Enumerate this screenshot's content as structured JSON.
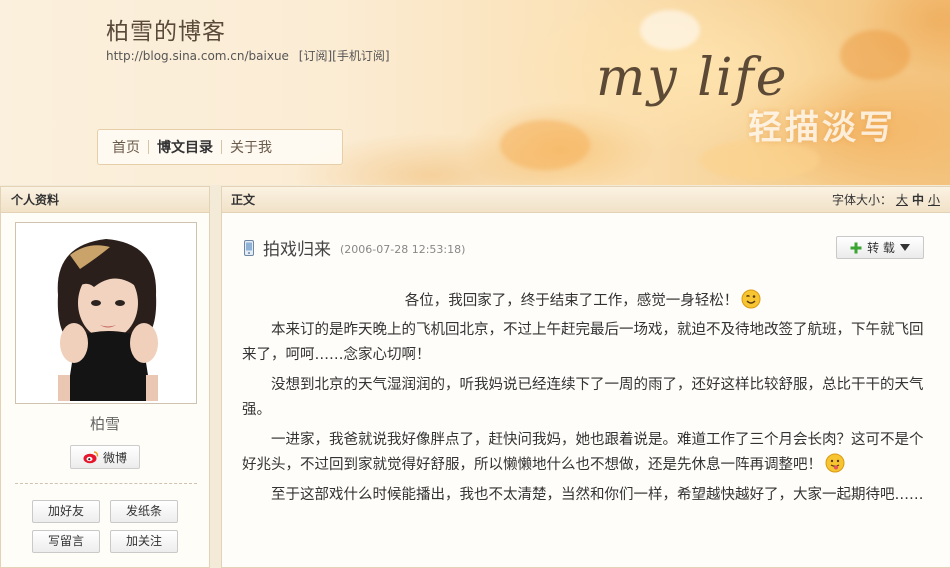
{
  "header": {
    "blog_title": "柏雪的博客",
    "blog_url": "http://blog.sina.com.cn/baixue",
    "subscribe_link": "[订阅]",
    "mobile_subscribe_link": "[手机订阅]",
    "banner_title": "my life",
    "banner_slogan": "轻描淡写"
  },
  "nav": {
    "items": [
      {
        "label": "首页",
        "active": false
      },
      {
        "label": "博文目录",
        "active": true
      },
      {
        "label": "关于我",
        "active": false
      }
    ]
  },
  "sidebar": {
    "heading": "个人资料",
    "name": "柏雪",
    "weibo_label": "微博",
    "actions": {
      "add_friend": "加好友",
      "send_note": "发纸条",
      "write_message": "写留言",
      "follow": "加关注"
    }
  },
  "main": {
    "heading": "正文",
    "font_size_label": "字体大小：",
    "font_sizes": [
      {
        "label": "大",
        "current": false
      },
      {
        "label": "中",
        "current": true
      },
      {
        "label": "小",
        "current": false
      }
    ],
    "post_title": "拍戏归来",
    "post_time": "(2006-07-28 12:53:18)",
    "repost_label": "转 载",
    "paragraphs": [
      "各位，我回家了，终于结束了工作，感觉一身轻松！",
      "本来订的是昨天晚上的飞机回北京，不过上午赶完最后一场戏，就迫不及待地改签了航班，下午就飞回来了，呵呵……念家心切啊！",
      "没想到北京的天气湿润润的，听我妈说已经连续下了一周的雨了，还好这样比较舒服，总比干干的天气强。",
      "一进家，我爸就说我好像胖点了，赶快问我妈，她也跟着说是。难道工作了三个月会长肉？这可不是个好兆头，不过回到家就觉得好舒服，所以懒懒地什么也不想做，还是先休息一阵再调整吧！",
      "至于这部戏什么时候能播出，我也不太清楚，当然和你们一样，希望越快越好了，大家一起期待吧……"
    ]
  },
  "icons": {
    "post": "mobile-post-icon",
    "repost": "plus-icon",
    "weibo": "weibo-logo-icon",
    "emoji_1": "winking-smiley-icon",
    "emoji_2": "tongue-out-smiley-icon"
  },
  "colors": {
    "banner_warm": "#f3c27c",
    "panel_head": "#f1e2c8",
    "repost_plus": "#3aa532",
    "weibo_red": "#e6162d"
  }
}
